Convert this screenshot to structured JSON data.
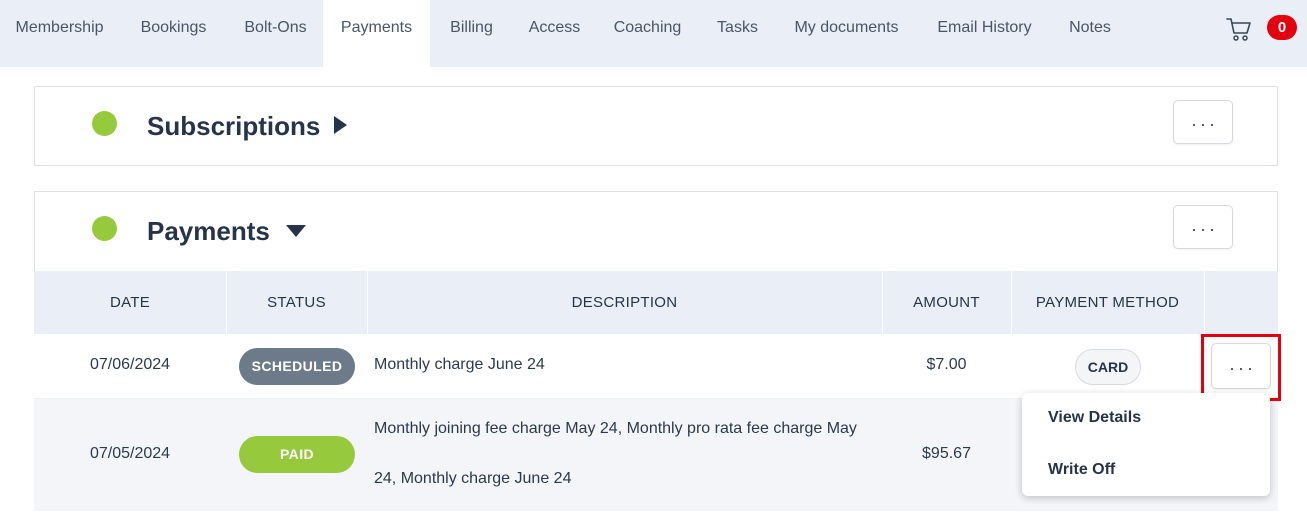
{
  "nav": {
    "tabs": [
      "Membership",
      "Bookings",
      "Bolt-Ons",
      "Payments",
      "Billing",
      "Access",
      "Coaching",
      "Tasks",
      "My documents",
      "Email History",
      "Notes"
    ],
    "active_tab": "Payments",
    "cart_icon": "shopping-cart-icon",
    "cart_count": "0"
  },
  "subscriptions": {
    "title": "Subscriptions",
    "status_color": "#97c93d",
    "more_label": "..."
  },
  "payments": {
    "title": "Payments",
    "status_color": "#97c93d",
    "more_label": "...",
    "columns": [
      "DATE",
      "STATUS",
      "DESCRIPTION",
      "AMOUNT",
      "PAYMENT METHOD"
    ],
    "rows": [
      {
        "date": "07/06/2024",
        "status": "SCHEDULED",
        "status_color": "#6c7a89",
        "description": "Monthly charge June 24",
        "amount": "$7.00",
        "method": "CARD",
        "more_label": "..."
      },
      {
        "date": "07/05/2024",
        "status": "PAID",
        "status_color": "#97c93d",
        "description_line1": "Monthly joining fee charge May 24, Monthly pro rata fee charge May",
        "description_line2": "24, Monthly charge June 24",
        "amount": "$95.67"
      }
    ]
  },
  "row_menu": {
    "items": [
      "View Details",
      "Write Off"
    ]
  },
  "colors": {
    "accent_red": "#e3000f",
    "nav_bg": "#e9eef7",
    "header_bg": "#eaeff7"
  }
}
